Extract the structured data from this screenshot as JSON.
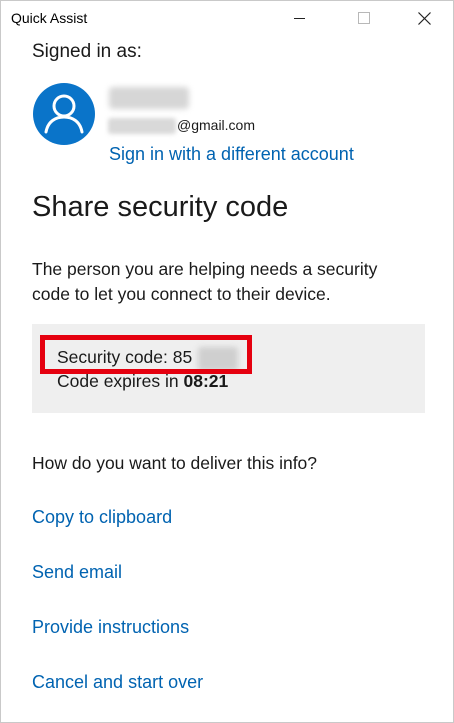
{
  "window": {
    "title": "Quick Assist"
  },
  "account": {
    "signed_in_label": "Signed in as:",
    "email_domain": "@gmail.com",
    "switch_account_link": "Sign in with a different account"
  },
  "security": {
    "section_title": "Share security code",
    "explanation": "The person you are helping needs a security code to let you connect to their device.",
    "code_label": "Security code: 85",
    "expires_label": "Code expires in",
    "expires_time": "08:21"
  },
  "delivery": {
    "question": "How do you want to deliver this info?",
    "options": [
      {
        "label": "Copy to clipboard"
      },
      {
        "label": "Send email"
      },
      {
        "label": "Provide instructions"
      },
      {
        "label": "Cancel and start over"
      }
    ]
  },
  "colors": {
    "accent_link": "#0063b1",
    "avatar_bg": "#0a74c9",
    "highlight": "#e5000f",
    "panel_bg": "#efefef"
  },
  "icons": {
    "avatar": "person-icon",
    "minimize": "minimize-icon",
    "maximize": "maximize-icon",
    "close": "close-icon"
  }
}
